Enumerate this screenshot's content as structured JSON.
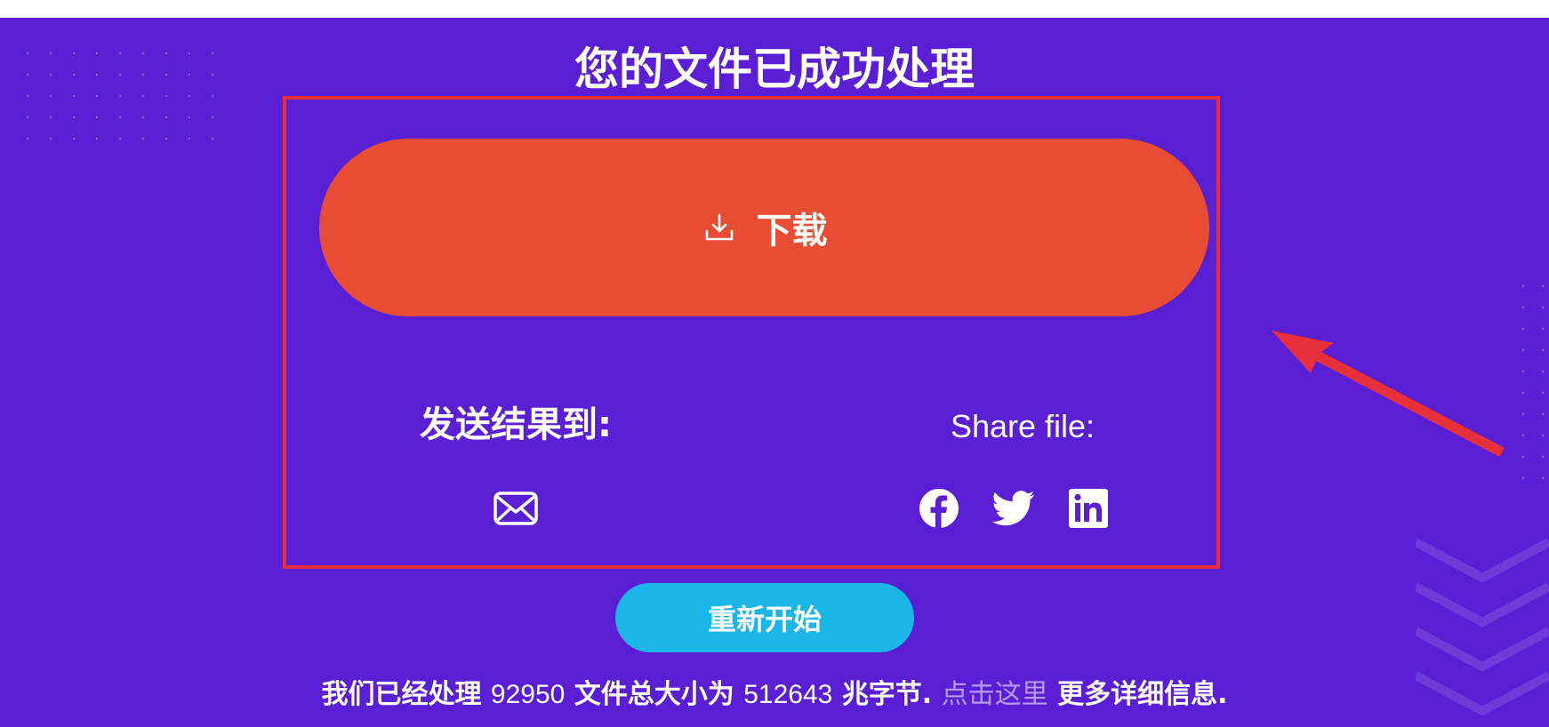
{
  "header": {
    "title": "您的文件已成功处理"
  },
  "download": {
    "label": "下载",
    "icon": "download-icon"
  },
  "send_results": {
    "label": "发送结果到:",
    "email_icon": "envelope-icon"
  },
  "share": {
    "label": "Share file:",
    "icons": [
      "facebook-icon",
      "twitter-icon",
      "linkedin-icon"
    ]
  },
  "restart": {
    "label": "重新开始"
  },
  "stats": {
    "prefix": "我们已经处理",
    "files_count": "92950",
    "middle": "文件总大小为",
    "total_size": "512643",
    "unit": "兆字节.",
    "link_text": "点击这里",
    "suffix": "更多详细信息."
  },
  "colors": {
    "background": "#5a1fd4",
    "download_button": "#e84c33",
    "restart_button": "#1ab6e8",
    "highlight_frame": "#e8303a",
    "link": "#b89af0"
  }
}
